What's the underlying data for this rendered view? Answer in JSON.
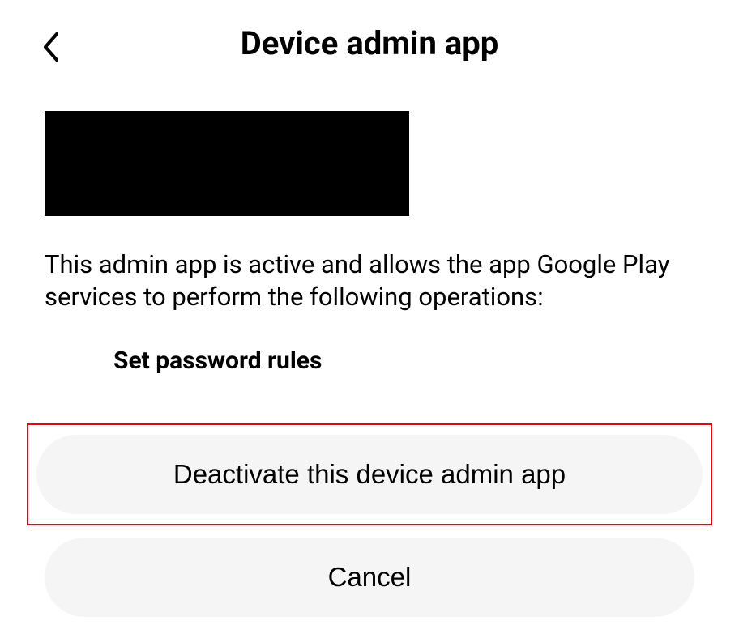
{
  "header": {
    "title": "Device admin app"
  },
  "content": {
    "description": "This admin app is active and allows the app Google Play services to perform the following operations:",
    "operations": [
      "Set password rules"
    ]
  },
  "buttons": {
    "deactivate": "Deactivate this device admin app",
    "cancel": "Cancel"
  }
}
